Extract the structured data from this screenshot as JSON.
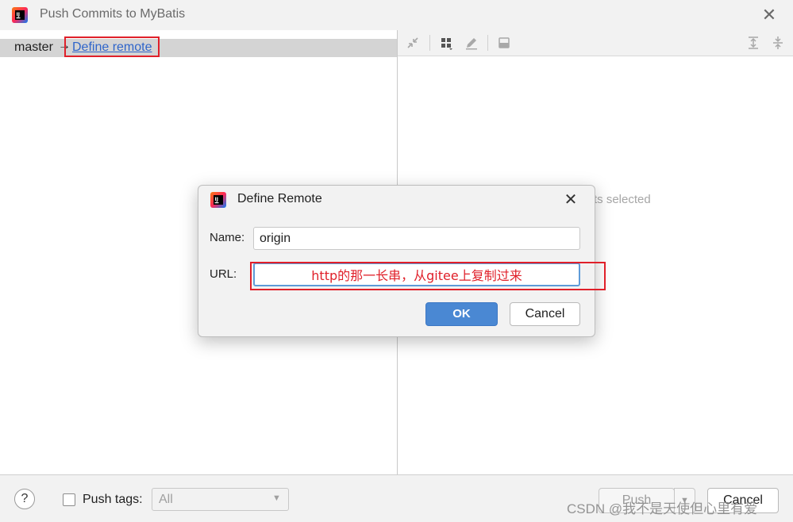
{
  "window": {
    "title": "Push Commits to MyBatis",
    "app_icon": "intellij-idea-icon"
  },
  "left_panel": {
    "branch": "master",
    "arrow": "→",
    "define_remote_link": "Define remote"
  },
  "right_panel": {
    "empty_text": "ts selected",
    "toolbar_icons": [
      "collapse-arrows-icon",
      "group-by-icon",
      "edit-icon",
      "preview-panel-icon",
      "expand-all-icon",
      "collapse-all-icon"
    ]
  },
  "dialog": {
    "title": "Define Remote",
    "name_label": "Name:",
    "name_value": "origin",
    "url_label": "URL:",
    "url_value": "http的那一长串，从gitee上复制过来",
    "ok_label": "OK",
    "cancel_label": "Cancel"
  },
  "bottom": {
    "help": "?",
    "push_tags_label": "Push tags:",
    "tags_select_value": "All",
    "push_label": "Push",
    "cancel_label": "Cancel"
  },
  "watermark": "CSDN @我不是天使但心里有爱",
  "colors": {
    "annotation_red": "#e0202a",
    "link_blue": "#2f65ca",
    "ok_blue": "#4a88d3"
  }
}
